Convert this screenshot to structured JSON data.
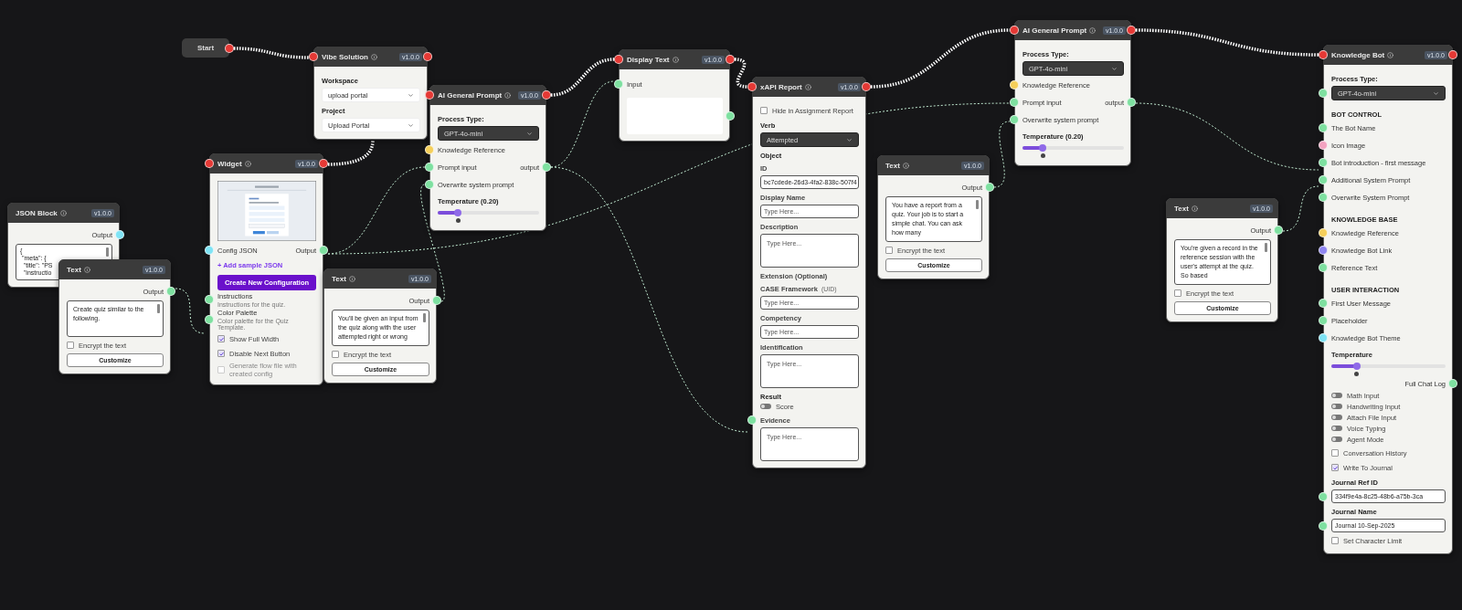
{
  "nodes": [
    {
      "kind": "start",
      "title": "Start",
      "exec_out": true
    },
    {
      "kind": "node",
      "title": "Vibe Solution",
      "version": "v1.0.0",
      "exec_in": true,
      "exec_out": true,
      "rows": [
        {
          "kind": "heading",
          "label": "Workspace"
        },
        {
          "kind": "select",
          "value": "upload portal",
          "dark": false
        },
        {
          "kind": "heading",
          "label": "Project"
        },
        {
          "kind": "select",
          "value": "Upload Portal",
          "dark": false
        }
      ]
    },
    {
      "kind": "node",
      "title": "Widget",
      "version": "v1.0.0",
      "exec_in": true,
      "exec_out": true,
      "rows": [
        {
          "kind": "preview"
        },
        {
          "kind": "label",
          "label": "Config JSON",
          "port_in": {
            "color": "#7fe3f5"
          },
          "out_label": "Output",
          "port_out": {
            "color": "#7ee0a0"
          }
        },
        {
          "kind": "link",
          "label": "+ Add sample JSON"
        },
        {
          "kind": "primary-button",
          "label": "Create New Configuration"
        },
        {
          "kind": "label",
          "label": "Instructions",
          "hint": "Instructions for the quiz.",
          "port_in": {
            "color": "#7ee0a0"
          }
        },
        {
          "kind": "label",
          "label": "Color Palette",
          "hint": "Color palette for the Quiz Template.",
          "port_in": {
            "color": "#7ee0a0"
          }
        },
        {
          "kind": "checkbox",
          "label": "Show Full Width",
          "checked": true,
          "disabled": false
        },
        {
          "kind": "checkbox",
          "label": "Disable Next Button",
          "checked": true,
          "disabled": false
        },
        {
          "kind": "checkbox",
          "label": "Generate flow file with created config",
          "checked": false,
          "disabled": true
        }
      ]
    },
    {
      "kind": "node",
      "title": "JSON Block",
      "version": "v1.0.0",
      "rows": [
        {
          "kind": "output",
          "label": "Output",
          "port_out": {
            "color": "#7fe3f5"
          }
        },
        {
          "kind": "code",
          "text": "{\n \"meta\": {\n  \"title\": \"PS\n  \"instructio"
        }
      ]
    },
    {
      "kind": "node",
      "title": "Text",
      "version": "v1.0.0",
      "rows": [
        {
          "kind": "output",
          "label": "Output",
          "port_out": {
            "color": "#7ee0a0"
          }
        },
        {
          "kind": "textarea",
          "text": "Create quiz similar to the following."
        },
        {
          "kind": "checkbox",
          "label": "Encrypt the text",
          "checked": false,
          "disabled": false
        },
        {
          "kind": "button",
          "label": "Customize"
        }
      ]
    },
    {
      "kind": "node",
      "title": "AI General Prompt",
      "version": "v1.0.0",
      "exec_in": true,
      "exec_out": true,
      "rows": [
        {
          "kind": "heading",
          "label": "Process Type:"
        },
        {
          "kind": "select",
          "value": "GPT-4o-mini",
          "dark": true
        },
        {
          "kind": "label",
          "label": "Knowledge Reference",
          "port_in": {
            "color": "#f5cf5a"
          }
        },
        {
          "kind": "label",
          "label": "Prompt input",
          "port_in": {
            "color": "#7ee0a0"
          },
          "out_label": "output",
          "port_out": {
            "color": "#7ee0a0"
          }
        },
        {
          "kind": "label",
          "label": "Overwrite system prompt",
          "port_in": {
            "color": "#7ee0a0"
          }
        },
        {
          "kind": "heading",
          "label": "Temperature (0.20)"
        },
        {
          "kind": "slider",
          "level": 0.2
        }
      ]
    },
    {
      "kind": "node",
      "title": "Text",
      "version": "v1.0.0",
      "rows": [
        {
          "kind": "output",
          "label": "Output",
          "port_out": {
            "color": "#7ee0a0"
          }
        },
        {
          "kind": "textarea",
          "text": "You'll be given an input from the quiz along with the user attempted right or wrong"
        },
        {
          "kind": "checkbox",
          "label": "Encrypt the text",
          "checked": false,
          "disabled": false
        },
        {
          "kind": "button",
          "label": "Customize"
        }
      ]
    },
    {
      "kind": "node",
      "title": "Display Text",
      "version": "v1.0.0",
      "exec_in": true,
      "exec_out": true,
      "rows": [
        {
          "kind": "label",
          "label": "Input",
          "port_in": {
            "color": "#7ee0a0"
          }
        },
        {
          "kind": "blank",
          "port_out": {
            "color": "#7ee0a0"
          }
        }
      ]
    },
    {
      "kind": "node",
      "title": "xAPI Report",
      "version": "v1.0.0",
      "exec_in": true,
      "exec_out": true,
      "rows": [
        {
          "kind": "checkbox",
          "label": "Hide in Assignment Report",
          "checked": false,
          "disabled": false
        },
        {
          "kind": "heading",
          "label": "Verb"
        },
        {
          "kind": "select",
          "value": "Attempted",
          "dark": true
        },
        {
          "kind": "heading",
          "label": "Object"
        },
        {
          "kind": "field",
          "label": "ID"
        },
        {
          "kind": "input",
          "value": "bc7cdede-26d3-4fa2-838c-507f4"
        },
        {
          "kind": "field",
          "label": "Display Name"
        },
        {
          "kind": "input",
          "placeholder": "Type Here..."
        },
        {
          "kind": "field",
          "label": "Description"
        },
        {
          "kind": "area",
          "placeholder": "Type Here..."
        },
        {
          "kind": "field",
          "label": "Extension (Optional)"
        },
        {
          "kind": "field",
          "label": "CASE Framework",
          "note": "(UID)"
        },
        {
          "kind": "input",
          "placeholder": "Type Here..."
        },
        {
          "kind": "field",
          "label": "Competency"
        },
        {
          "kind": "input",
          "placeholder": "Type Here..."
        },
        {
          "kind": "field",
          "label": "Identification"
        },
        {
          "kind": "area",
          "placeholder": "Type Here..."
        },
        {
          "kind": "heading",
          "label": "Result"
        },
        {
          "kind": "toggle",
          "label": "Score",
          "on": false
        },
        {
          "kind": "field",
          "label": "Evidence",
          "port_in": {
            "color": "#7ee0a0"
          }
        },
        {
          "kind": "area",
          "placeholder": "Type Here..."
        }
      ]
    },
    {
      "kind": "node",
      "title": "Text",
      "version": "v1.0.0",
      "rows": [
        {
          "kind": "output",
          "label": "Output",
          "port_out": {
            "color": "#7ee0a0"
          }
        },
        {
          "kind": "textarea",
          "text": "You have a report from a quiz. Your job is to start a simple chat. You can ask how many"
        },
        {
          "kind": "checkbox",
          "label": "Encrypt the text",
          "checked": false,
          "disabled": false
        },
        {
          "kind": "button",
          "label": "Customize"
        }
      ]
    },
    {
      "kind": "node",
      "title": "AI General Prompt",
      "version": "v1.0.0",
      "exec_in": true,
      "exec_out": true,
      "rows": [
        {
          "kind": "heading",
          "label": "Process Type:"
        },
        {
          "kind": "select",
          "value": "GPT-4o-mini",
          "dark": true
        },
        {
          "kind": "label",
          "label": "Knowledge Reference",
          "port_in": {
            "color": "#f5cf5a"
          }
        },
        {
          "kind": "label",
          "label": "Prompt input",
          "port_in": {
            "color": "#7ee0a0"
          },
          "out_label": "output",
          "port_out": {
            "color": "#7ee0a0"
          }
        },
        {
          "kind": "label",
          "label": "Overwrite system prompt",
          "port_in": {
            "color": "#7ee0a0"
          }
        },
        {
          "kind": "heading",
          "label": "Temperature (0.20)"
        },
        {
          "kind": "slider",
          "level": 0.2
        }
      ]
    },
    {
      "kind": "node",
      "title": "Text",
      "version": "v1.0.0",
      "rows": [
        {
          "kind": "output",
          "label": "Output",
          "port_out": {
            "color": "#7ee0a0"
          }
        },
        {
          "kind": "textarea",
          "text": "You're given a record in the reference session with the user's attempt at the quiz. So based"
        },
        {
          "kind": "checkbox",
          "label": "Encrypt the text",
          "checked": false,
          "disabled": false
        },
        {
          "kind": "button",
          "label": "Customize"
        }
      ]
    },
    {
      "kind": "node",
      "title": "Knowledge Bot",
      "version": "v1.0.0",
      "exec_in": true,
      "exec_out": true,
      "rows": [
        {
          "kind": "heading",
          "label": "Process Type:"
        },
        {
          "kind": "select",
          "value": "GPT-4o-mini",
          "dark": true,
          "port_in": {
            "color": "#7ee0a0"
          }
        },
        {
          "kind": "section",
          "label": "BOT CONTROL"
        },
        {
          "kind": "label",
          "label": "The Bot Name",
          "port_in": {
            "color": "#7ee0a0"
          }
        },
        {
          "kind": "label",
          "label": "Icon Image",
          "port_in": {
            "color": "#f3a3c0"
          }
        },
        {
          "kind": "label",
          "label": "Bot introduction - first message",
          "port_in": {
            "color": "#7ee0a0"
          }
        },
        {
          "kind": "label",
          "label": "Additional System Prompt",
          "port_in": {
            "color": "#7ee0a0"
          }
        },
        {
          "kind": "label",
          "label": "Overwrite System Prompt",
          "port_in": {
            "color": "#7ee0a0"
          }
        },
        {
          "kind": "section",
          "label": "KNOWLEDGE BASE"
        },
        {
          "kind": "label",
          "label": "Knowledge Reference",
          "port_in": {
            "color": "#f5cf5a"
          }
        },
        {
          "kind": "label",
          "label": "Knowledge Bot Link",
          "port_in": {
            "color": "#8f86f0"
          }
        },
        {
          "kind": "label",
          "label": "Reference Text",
          "port_in": {
            "color": "#7ee0a0"
          }
        },
        {
          "kind": "section",
          "label": "USER INTERACTION"
        },
        {
          "kind": "label",
          "label": "First User Message",
          "port_in": {
            "color": "#7ee0a0"
          }
        },
        {
          "kind": "label",
          "label": "Placeholder",
          "port_in": {
            "color": "#7ee0a0"
          }
        },
        {
          "kind": "label",
          "label": "Knowledge Bot Theme",
          "port_in": {
            "color": "#7fe3f5"
          }
        },
        {
          "kind": "heading",
          "label": "Temperature"
        },
        {
          "kind": "slider",
          "level": 0.22
        },
        {
          "kind": "output",
          "label": "Full Chat Log",
          "port_out": {
            "color": "#7ee0a0"
          }
        },
        {
          "kind": "toggle",
          "label": "Math Input",
          "on": false
        },
        {
          "kind": "toggle",
          "label": "Handwriting Input",
          "on": false
        },
        {
          "kind": "toggle",
          "label": "Attach File Input",
          "on": false
        },
        {
          "kind": "toggle",
          "label": "Voice Typing",
          "on": false
        },
        {
          "kind": "toggle",
          "label": "Agent Mode",
          "on": false
        },
        {
          "kind": "checkbox",
          "label": "Conversation History",
          "checked": false,
          "disabled": false
        },
        {
          "kind": "checkbox",
          "label": "Write To Journal",
          "checked": true,
          "disabled": false
        },
        {
          "kind": "heading",
          "label": "Journal Ref ID"
        },
        {
          "kind": "input",
          "value": "334f9e4a-8c25-48b6-a75b-3ca",
          "port_in": {
            "color": "#7ee0a0"
          }
        },
        {
          "kind": "heading",
          "label": "Journal Name"
        },
        {
          "kind": "input",
          "value": "Journal 10-Sep-2025",
          "port_in": {
            "color": "#7ee0a0"
          }
        },
        {
          "kind": "checkbox",
          "label": "Set Character Limit",
          "checked": false,
          "disabled": false
        }
      ]
    }
  ]
}
